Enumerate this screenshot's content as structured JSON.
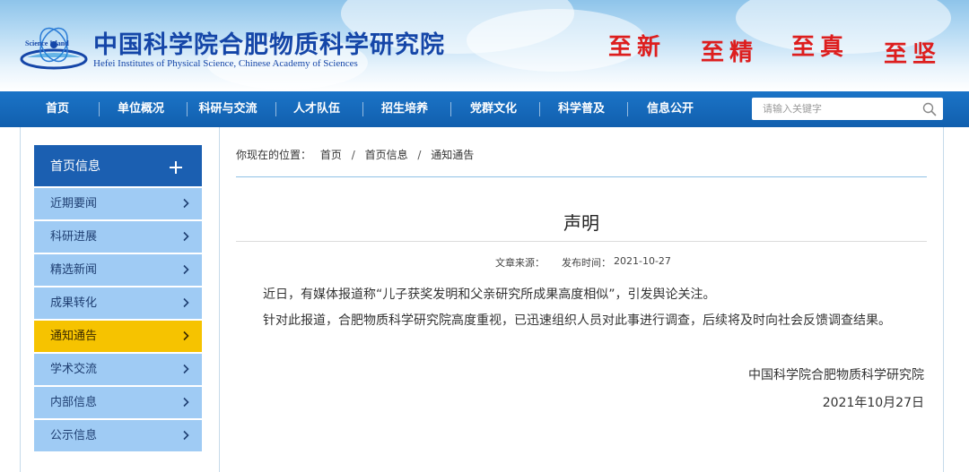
{
  "header": {
    "logo_badge_text": "Science Island",
    "logo_cn": "中国科学院合肥物质科学研究院",
    "logo_en": "Hefei Institutes of Physical Science, Chinese Academy of Sciences",
    "motto": [
      "至新",
      "至精",
      "至真",
      "至坚"
    ],
    "motto_color": "#dd1e1e",
    "brand_color": "#1546a8"
  },
  "nav": {
    "items": [
      "首页",
      "单位概况",
      "科研与交流",
      "人才队伍",
      "招生培养",
      "党群文化",
      "科学普及",
      "信息公开"
    ],
    "bar_color": "#1466b8"
  },
  "search": {
    "placeholder": "请输入关键字",
    "icon": "search-icon"
  },
  "sidebar": {
    "heading": "首页信息",
    "heading_icon": "plus-icon",
    "heading_color": "#1b5fb1",
    "item_color": "#9fcbf4",
    "active_color": "#f6c300",
    "items": [
      {
        "label": "近期要闻",
        "active": false
      },
      {
        "label": "科研进展",
        "active": false
      },
      {
        "label": "精选新闻",
        "active": false
      },
      {
        "label": "成果转化",
        "active": false
      },
      {
        "label": "通知通告",
        "active": true
      },
      {
        "label": "学术交流",
        "active": false
      },
      {
        "label": "内部信息",
        "active": false
      },
      {
        "label": "公示信息",
        "active": false
      }
    ]
  },
  "breadcrumb": {
    "prefix": "你现在的位置：",
    "items": [
      "首页",
      "首页信息",
      "通知通告"
    ],
    "separator": "/"
  },
  "article": {
    "title": "声明",
    "source_label": "文章来源：",
    "date_label": "发布时间：",
    "date": "2021-10-27",
    "paragraphs": [
      "近日，有媒体报道称“儿子获奖发明和父亲研究所成果高度相似”，引发舆论关注。",
      "针对此报道，合肥物质科学研究院高度重视，已迅速组织人员对此事进行调查，后续将及时向社会反馈调查结果。"
    ],
    "signature": "中国科学院合肥物质科学研究院",
    "signature_date": "2021年10月27日"
  }
}
